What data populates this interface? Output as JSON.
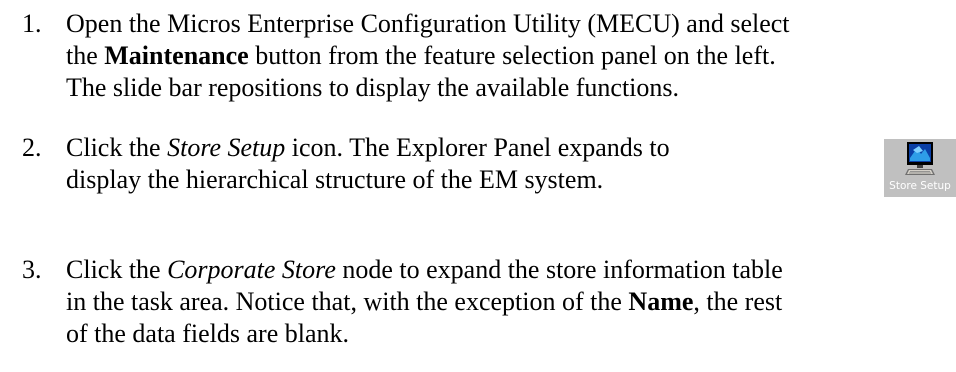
{
  "steps": [
    {
      "number": "1.",
      "lines": [
        [
          "Open the Micros Enterprise Configuration Utility (MECU) and select"
        ],
        [
          "the ",
          "Maintenance",
          " button from the feature selection panel on the left."
        ],
        [
          "The slide bar repositions to display the available functions."
        ]
      ]
    },
    {
      "number": "2.",
      "lines": [
        [
          "Click the ",
          "Store Setup",
          " icon.  The Explorer Panel expands to"
        ],
        [
          "display the hierarchical structure of the EM system."
        ]
      ]
    },
    {
      "number": "3.",
      "lines": [
        [
          "Click the ",
          "Corporate Store",
          " node to expand the store information table"
        ],
        [
          "in the task area. Notice that, with the exception of the ",
          "Name",
          ", the rest"
        ],
        [
          "of the data fields are blank."
        ]
      ]
    }
  ],
  "store_setup_icon": {
    "icon": "computer-monitor-icon",
    "caption": "Store Setup"
  }
}
